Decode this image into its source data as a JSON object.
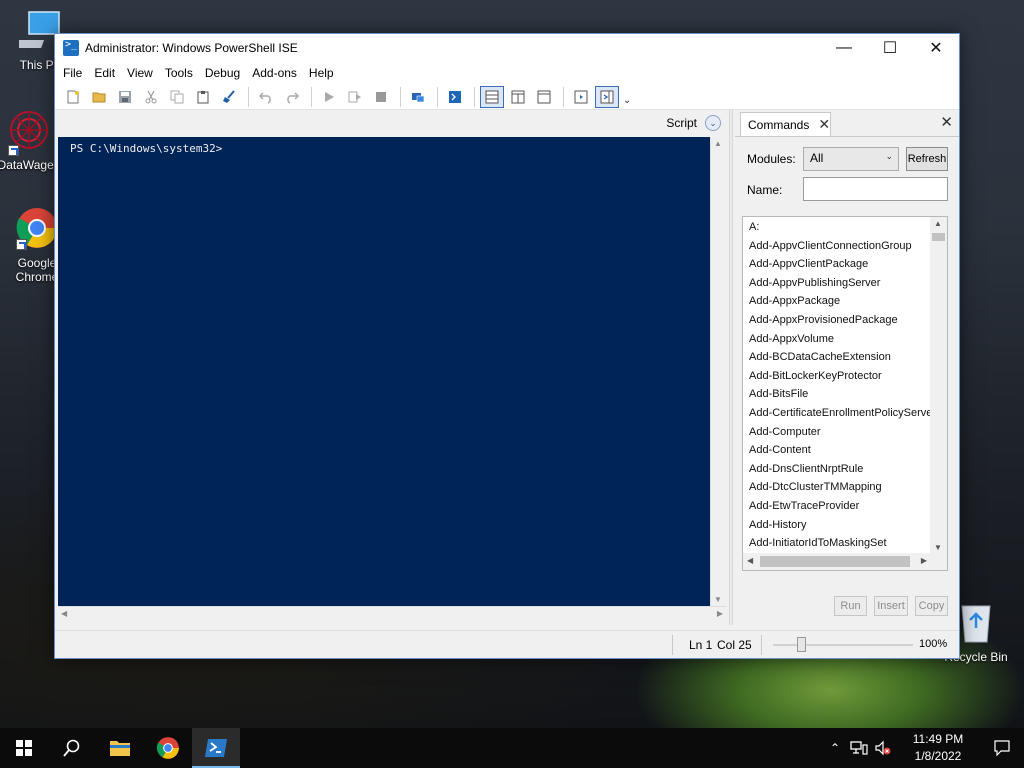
{
  "desktop": {
    "icons": [
      {
        "label": "This PC"
      },
      {
        "label": "DataWagen"
      },
      {
        "label": "Google Chrome"
      },
      {
        "label": "Recycle Bin"
      }
    ]
  },
  "window": {
    "title": "Administrator: Windows PowerShell ISE",
    "controls": {
      "minimize": "—",
      "maximize": "☐",
      "close": "✕"
    }
  },
  "menu": [
    "File",
    "Edit",
    "View",
    "Tools",
    "Debug",
    "Add-ons",
    "Help"
  ],
  "toolbar": {
    "buttons": [
      "new-script",
      "open",
      "save",
      "cut",
      "copy",
      "paste",
      "clear-console",
      "undo",
      "redo",
      "run-script",
      "run-selection",
      "stop",
      "new-remote-tab",
      "start-powershell",
      "show-script-top",
      "show-script-right",
      "show-script-maximized",
      "show-script-pane",
      "show-command-addon"
    ],
    "overflow": "⌄"
  },
  "script_bar": {
    "label": "Script"
  },
  "console": {
    "prompt": "PS C:\\Windows\\system32>"
  },
  "commands_pane": {
    "tab_label": "Commands",
    "modules_label": "Modules:",
    "modules_value": "All",
    "refresh_label": "Refresh",
    "name_label": "Name:",
    "name_value": "",
    "commands": [
      "A:",
      "Add-AppvClientConnectionGroup",
      "Add-AppvClientPackage",
      "Add-AppvPublishingServer",
      "Add-AppxPackage",
      "Add-AppxProvisionedPackage",
      "Add-AppxVolume",
      "Add-BCDataCacheExtension",
      "Add-BitLockerKeyProtector",
      "Add-BitsFile",
      "Add-CertificateEnrollmentPolicyServer",
      "Add-Computer",
      "Add-Content",
      "Add-DnsClientNrptRule",
      "Add-DtcClusterTMMapping",
      "Add-EtwTraceProvider",
      "Add-History",
      "Add-InitiatorIdToMaskingSet"
    ],
    "run_label": "Run",
    "insert_label": "Insert",
    "copy_label": "Copy"
  },
  "status": {
    "ln": "Ln 1",
    "col": "Col 25",
    "zoom": "100%"
  },
  "taskbar": {
    "clock_time": "11:49 PM",
    "clock_date": "1/8/2022"
  },
  "colors": {
    "console_bg": "#012456",
    "accent": "#76b9ed"
  }
}
